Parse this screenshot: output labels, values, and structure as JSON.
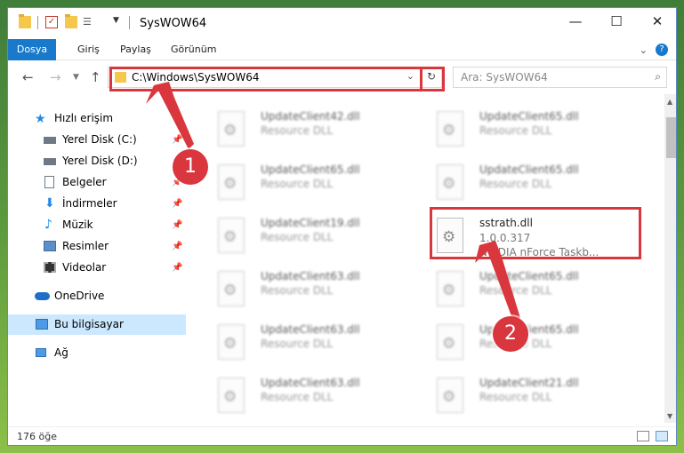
{
  "window": {
    "title": "SysWOW64"
  },
  "ribbon": {
    "tabs": [
      "Dosya",
      "Giriş",
      "Paylaş",
      "Görünüm"
    ]
  },
  "address": {
    "path": "C:\\Windows\\SysWOW64"
  },
  "search": {
    "placeholder": "Ara: SysWOW64"
  },
  "sidebar": {
    "items": [
      {
        "label": "Hızlı erişim",
        "icon": "star-icon"
      },
      {
        "label": "Yerel Disk (C:)",
        "icon": "drive-icon"
      },
      {
        "label": "Yerel Disk (D:)",
        "icon": "drive-icon"
      },
      {
        "label": "Belgeler",
        "icon": "documents-icon"
      },
      {
        "label": "İndirmeler",
        "icon": "download-icon"
      },
      {
        "label": "Müzik",
        "icon": "music-icon"
      },
      {
        "label": "Resimler",
        "icon": "pictures-icon"
      },
      {
        "label": "Videolar",
        "icon": "video-icon"
      },
      {
        "label": "OneDrive",
        "icon": "cloud-icon"
      },
      {
        "label": "Bu bilgisayar",
        "icon": "computer-icon"
      },
      {
        "label": "Ağ",
        "icon": "network-icon"
      }
    ]
  },
  "files": [
    {
      "name": "UpdateClient42.dll",
      "type": "Resource DLL"
    },
    {
      "name": "UpdateClient65.dll",
      "type": "Resource DLL"
    },
    {
      "name": "UpdateClient65.dll",
      "type": "Resource DLL"
    },
    {
      "name": "UpdateClient65.dll",
      "type": "Resource DLL"
    },
    {
      "name": "UpdateClient19.dll",
      "type": "Resource DLL"
    },
    {
      "name": "sstrath.dll",
      "version": "1.0.0.317",
      "type": "NVIDIA nForce Taskb..."
    },
    {
      "name": "UpdateClient63.dll",
      "type": "Resource DLL"
    },
    {
      "name": "UpdateClient65.dll",
      "type": "Resource DLL"
    },
    {
      "name": "UpdateClient63.dll",
      "type": "Resource DLL"
    },
    {
      "name": "UpdateClient65.dll",
      "type": "Resource DLL"
    },
    {
      "name": "UpdateClient63.dll",
      "type": "Resource DLL"
    },
    {
      "name": "UpdateClient21.dll",
      "type": "Resource DLL"
    }
  ],
  "status": {
    "count": "176 öğe"
  },
  "annotations": {
    "step1": "1",
    "step2": "2",
    "color": "#d9363e"
  }
}
